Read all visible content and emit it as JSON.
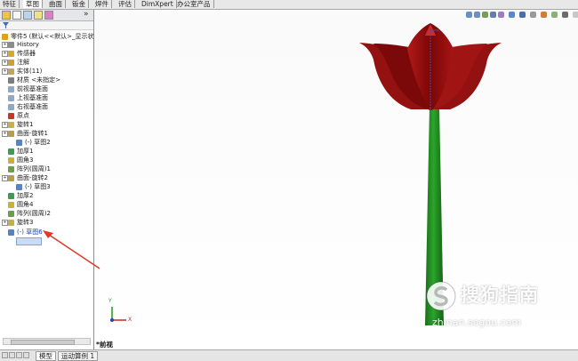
{
  "tabs": [
    "特征",
    "草图",
    "曲面",
    "钣金",
    "焊件",
    "评估",
    "DimXpert",
    "办公室产品"
  ],
  "active_tab": "草图",
  "panel": {
    "collapse_label": "»",
    "filter_icon": "filter-icon",
    "items": [
      {
        "label": "零件5 (默认<<默认>_显示状态",
        "icon": "part-icon"
      },
      {
        "label": "History",
        "icon": "history-icon"
      },
      {
        "label": "传感器",
        "icon": "sensor-icon"
      },
      {
        "label": "注解",
        "icon": "annotation-icon"
      },
      {
        "label": "实体(11)",
        "icon": "solid-bodies-icon"
      },
      {
        "label": "材质 <未指定>",
        "icon": "material-icon"
      },
      {
        "label": "前视基准面",
        "icon": "plane-icon"
      },
      {
        "label": "上视基准面",
        "icon": "plane-icon"
      },
      {
        "label": "右视基准面",
        "icon": "plane-icon"
      },
      {
        "label": "原点",
        "icon": "origin-icon"
      },
      {
        "label": "旋转1",
        "icon": "revolve-icon"
      },
      {
        "label": "曲面-旋转1",
        "icon": "surface-revolve-icon"
      },
      {
        "label": "(-) 草图2",
        "icon": "sketch-icon"
      },
      {
        "label": "加厚1",
        "icon": "thicken-icon"
      },
      {
        "label": "圆角3",
        "icon": "fillet-icon"
      },
      {
        "label": "阵列(圆周)1",
        "icon": "circular-pattern-icon"
      },
      {
        "label": "曲面-旋转2",
        "icon": "surface-revolve-icon"
      },
      {
        "label": "(-) 草图3",
        "icon": "sketch-icon"
      },
      {
        "label": "加厚2",
        "icon": "thicken-icon"
      },
      {
        "label": "圆角4",
        "icon": "fillet-icon"
      },
      {
        "label": "阵列(圆周)2",
        "icon": "circular-pattern-icon"
      },
      {
        "label": "旋转3",
        "icon": "revolve-icon"
      },
      {
        "label": "(-) 草图6",
        "icon": "sketch-icon"
      }
    ]
  },
  "viewport": {
    "view_label": "*前视",
    "watermark_text": "搜狗指南",
    "watermark_url": "zhinan.sogou.com",
    "triad_x": "X",
    "triad_y": "Y"
  },
  "bottom_tabs": [
    "模型",
    "运动算例 1"
  ],
  "colors": {
    "flower_red": "#8f0e0e",
    "stem_green": "#1d8a1d",
    "arrow_red": "#e03a2c",
    "selection_blue": "#c7dcf7"
  }
}
